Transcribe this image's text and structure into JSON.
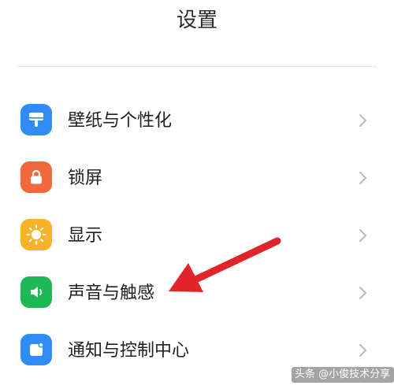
{
  "header": {
    "title": "设置"
  },
  "settings": {
    "items": [
      {
        "label": "壁纸与个性化",
        "icon": "wallpaper-brush-icon",
        "color": "#2f8cf5"
      },
      {
        "label": "锁屏",
        "icon": "lock-icon",
        "color": "#f26a3c"
      },
      {
        "label": "显示",
        "icon": "sun-brightness-icon",
        "color": "#f7b32b"
      },
      {
        "label": "声音与触感",
        "icon": "speaker-icon",
        "color": "#1db954"
      },
      {
        "label": "通知与控制中心",
        "icon": "notification-icon",
        "color": "#2f8cf5"
      }
    ]
  },
  "annotation": {
    "arrow_color": "#e0242a",
    "points_to": "声音与触感"
  },
  "watermark": {
    "text": "头条 @小俊技术分享"
  }
}
